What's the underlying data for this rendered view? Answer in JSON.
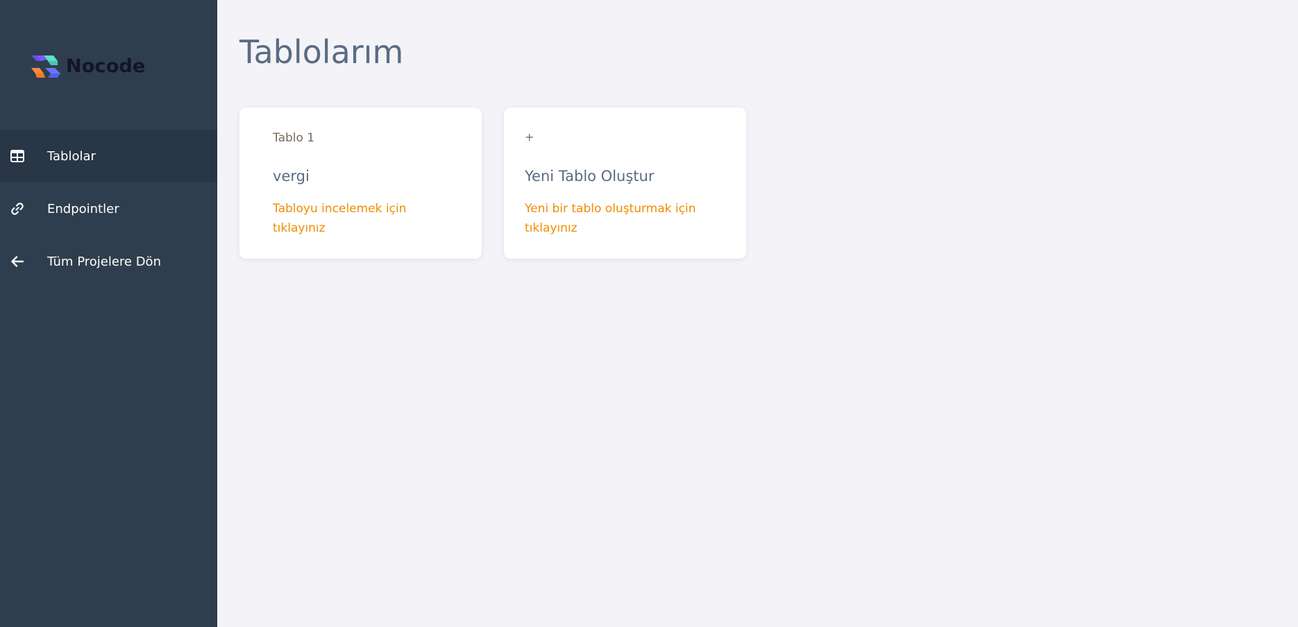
{
  "brand": {
    "name": "Nocode"
  },
  "sidebar": {
    "items": [
      {
        "label": "Tablolar",
        "icon": "table-icon",
        "active": true
      },
      {
        "label": "Endpointler",
        "icon": "link-icon",
        "active": false
      },
      {
        "label": "Tüm Projelere Dön",
        "icon": "arrow-left-icon",
        "active": false
      }
    ]
  },
  "main": {
    "title": "Tablolarım",
    "cards": [
      {
        "eyebrow": "Tablo 1",
        "name": "vergi",
        "hint": "Tabloyu incelemek için tıklayınız"
      },
      {
        "eyebrow": "+",
        "name": "Yeni Tablo Oluştur",
        "hint": "Yeni bir tablo oluşturmak için tıklayınız"
      }
    ]
  },
  "colors": {
    "sidebar_bg": "#2f3e4e",
    "sidebar_active_bg": "#283645",
    "page_bg": "#f3f3f8",
    "accent": "#f08c00",
    "title": "#5b6b82"
  }
}
